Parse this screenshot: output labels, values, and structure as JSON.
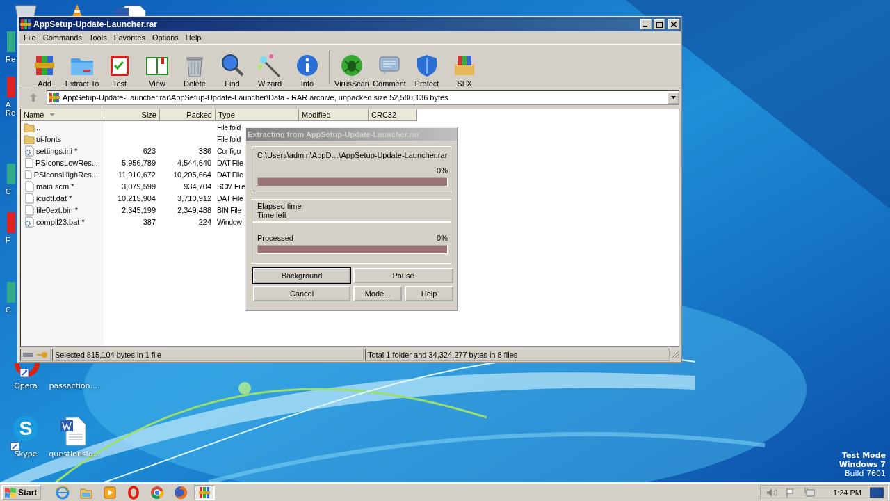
{
  "desktop": {
    "icons": [
      {
        "label": "Re",
        "kind": "edge"
      },
      {
        "label": "A Re",
        "kind": "edge"
      },
      {
        "label": "C",
        "kind": "edge"
      },
      {
        "label": "F",
        "kind": "edge"
      },
      {
        "label": "C",
        "kind": "edge"
      },
      {
        "label": "Opera",
        "kind": "opera"
      },
      {
        "label": "passaction....",
        "kind": "hidden"
      },
      {
        "label": "Skype",
        "kind": "skype",
        "glyph": "S"
      },
      {
        "label": "questionslo...",
        "kind": "word"
      }
    ],
    "os_notice": [
      "Test Mode",
      "Windows 7",
      "Build 7601"
    ]
  },
  "window": {
    "title": "AppSetup-Update-Launcher.rar",
    "menu": [
      "File",
      "Commands",
      "Tools",
      "Favorites",
      "Options",
      "Help"
    ],
    "toolbar": [
      {
        "label": "Add"
      },
      {
        "label": "Extract To"
      },
      {
        "label": "Test"
      },
      {
        "label": "View"
      },
      {
        "label": "Delete"
      },
      {
        "label": "Find"
      },
      {
        "label": "Wizard"
      },
      {
        "label": "Info"
      },
      {
        "label": "VirusScan"
      },
      {
        "label": "Comment"
      },
      {
        "label": "Protect"
      },
      {
        "label": "SFX"
      }
    ],
    "address": "AppSetup-Update-Launcher.rar\\AppSetup-Update-Launcher\\Data - RAR archive, unpacked size 52,580,136 bytes",
    "columns": [
      "Name",
      "Size",
      "Packed",
      "Type",
      "Modified",
      "CRC32"
    ],
    "rows": [
      {
        "kind": "folder",
        "name": "..",
        "size": "",
        "packed": "",
        "type": "File fold"
      },
      {
        "kind": "folder",
        "name": "ui-fonts",
        "size": "",
        "packed": "",
        "type": "File fold"
      },
      {
        "kind": "config",
        "name": "settings.ini *",
        "size": "623",
        "packed": "336",
        "type": "Configu"
      },
      {
        "kind": "file",
        "name": "PSIconsLowRes....",
        "size": "5,956,789",
        "packed": "4,544,640",
        "type": "DAT File"
      },
      {
        "kind": "file",
        "name": "PSIconsHighRes....",
        "size": "11,910,672",
        "packed": "10,205,664",
        "type": "DAT File"
      },
      {
        "kind": "file",
        "name": "main.scm *",
        "size": "3,079,599",
        "packed": "934,704",
        "type": "SCM File"
      },
      {
        "kind": "file",
        "name": "icudtl.dat *",
        "size": "10,215,904",
        "packed": "3,710,912",
        "type": "DAT File"
      },
      {
        "kind": "file",
        "name": "file0ext.bin *",
        "size": "2,345,199",
        "packed": "2,349,488",
        "type": "BIN File"
      },
      {
        "kind": "config",
        "name": "compil23.bat *",
        "size": "387",
        "packed": "224",
        "type": "Window"
      }
    ],
    "status": {
      "selection": "Selected 815,104 bytes in 1 file",
      "total": "Total 1 folder and 34,324,277 bytes in 8 files"
    }
  },
  "dialog": {
    "title": "Extracting from AppSetup-Update-Launcher.rar",
    "archive_path": "C:\\Users\\admin\\AppD…\\AppSetup-Update-Launcher.rar",
    "archive_percent": "0%",
    "archive_bar": {
      "level": 0
    },
    "elapsed_label": "Elapsed time",
    "time_left_label": "Time left",
    "processed_label": "Processed",
    "processed_percent": "0%",
    "processed_bar": {
      "level": 0
    },
    "buttons": [
      {
        "label": "Background",
        "default": true
      },
      {
        "label": "Pause",
        "default": false
      },
      {
        "label": "Cancel",
        "default": false
      },
      {
        "label": "Mode...",
        "default": false
      },
      {
        "label": "Help",
        "default": false
      }
    ]
  },
  "taskbar": {
    "start": "Start",
    "apps": [
      {
        "selected": false
      },
      {
        "selected": false
      },
      {
        "selected": false
      },
      {
        "selected": false
      },
      {
        "selected": false
      },
      {
        "selected": false
      },
      {
        "selected": true
      }
    ],
    "clock": "1:24 PM"
  }
}
